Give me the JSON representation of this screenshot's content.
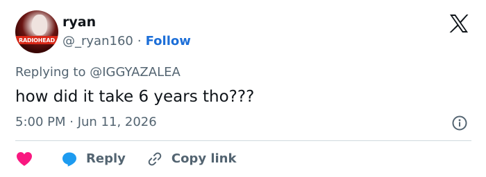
{
  "tweet": {
    "author": {
      "name": "ryan",
      "handle": "@_ryan160",
      "separator": "·",
      "follow_label": "Follow",
      "avatar_text": "RADIOHEAD"
    },
    "replying_to": "Replying to @IGGYAZALEA",
    "text": "how did it take 6 years tho???",
    "timestamp": "5:00 PM · Jun 11, 2026"
  },
  "actions": {
    "reply_label": "Reply",
    "copy_link_label": "Copy link"
  },
  "icons": {
    "logo": "x-logo-icon",
    "info": "info-icon",
    "like": "heart-icon",
    "reply": "reply-bubble-icon",
    "copy": "link-icon"
  },
  "colors": {
    "accent": "#1d6fd8",
    "like": "#f91880",
    "reply": "#1d9bf0",
    "muted": "#536471",
    "text": "#0f1419"
  }
}
